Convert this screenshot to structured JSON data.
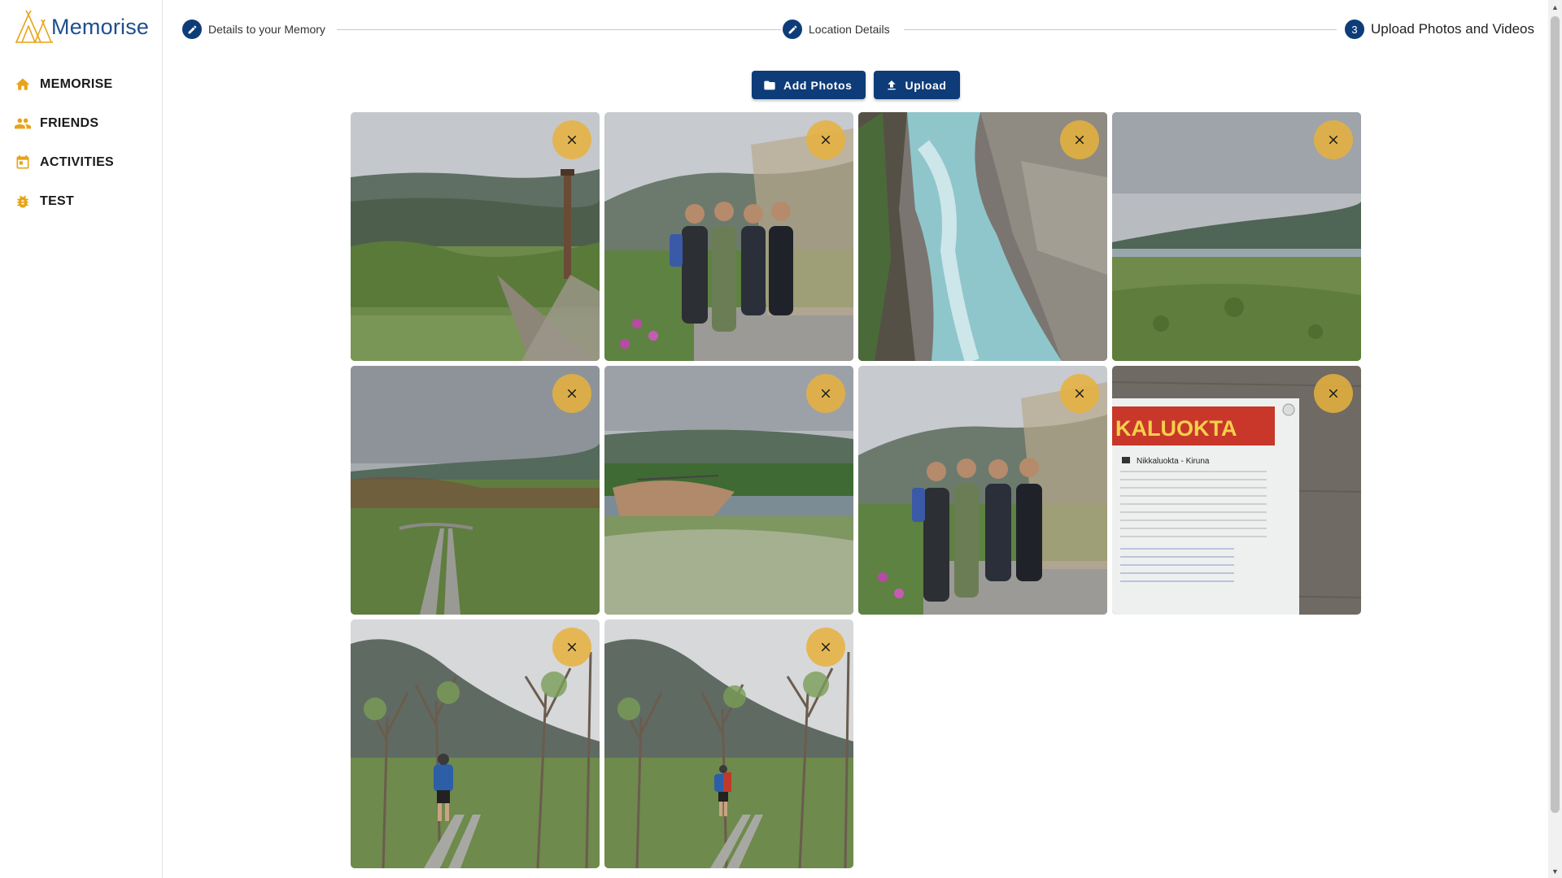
{
  "brand": {
    "name": "Memorise"
  },
  "sidebar": {
    "items": [
      {
        "label": "MEMORISE",
        "icon": "home-icon"
      },
      {
        "label": "FRIENDS",
        "icon": "people-icon"
      },
      {
        "label": "ACTIVITIES",
        "icon": "calendar-icon"
      },
      {
        "label": "TEST",
        "icon": "bug-icon"
      }
    ]
  },
  "stepper": {
    "steps": [
      {
        "label": "Details to your Memory",
        "icon": "pencil-icon"
      },
      {
        "label": "Location Details",
        "icon": "pencil-icon"
      },
      {
        "label": "Upload Photos and Videos",
        "number": "3"
      }
    ]
  },
  "actions": {
    "add_photos": "Add Photos",
    "upload": "Upload"
  },
  "photos": [
    {
      "icon": "photo-mountain-chimney"
    },
    {
      "icon": "photo-group-four"
    },
    {
      "icon": "photo-river-rapids"
    },
    {
      "icon": "photo-tundra-lake"
    },
    {
      "icon": "photo-boardwalk-path"
    },
    {
      "icon": "photo-river-bridge"
    },
    {
      "icon": "photo-group-four"
    },
    {
      "icon": "photo-kaluokta-sign"
    },
    {
      "icon": "photo-hiker-birch"
    },
    {
      "icon": "photo-hiker-birch"
    }
  ],
  "sign_text": {
    "title": "KALUOKTA",
    "route": "Nikkaluokta - Kiruna"
  },
  "colors": {
    "primary": "#0d3c78",
    "accent": "#e8a317",
    "brand_text": "#1f4e8c"
  }
}
